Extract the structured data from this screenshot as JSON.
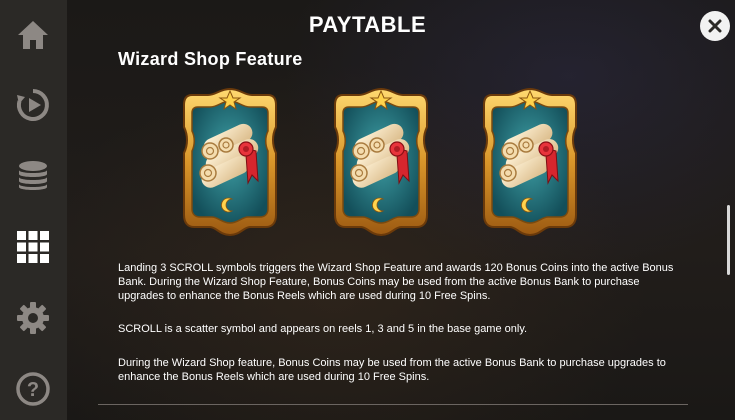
{
  "header": {
    "title": "PAYTABLE"
  },
  "sidebar": {
    "items": [
      {
        "icon": "home-icon"
      },
      {
        "icon": "autoplay-icon"
      },
      {
        "icon": "coins-stack-icon"
      },
      {
        "icon": "paytable-grid-icon",
        "active": true
      },
      {
        "icon": "gear-icon"
      },
      {
        "icon": "help-icon"
      }
    ]
  },
  "section": {
    "title": "Wizard Shop Feature",
    "symbols": [
      "scroll-symbol-icon",
      "scroll-symbol-icon",
      "scroll-symbol-icon"
    ],
    "paragraphs": [
      "Landing 3 SCROLL symbols triggers the Wizard Shop Feature and awards 120 Bonus Coins into the active Bonus Bank. During the Wizard Shop Feature, Bonus Coins may be used from the active Bonus Bank to purchase upgrades to enhance the Bonus Reels which are used during 10 Free Spins.",
      "SCROLL is a scatter symbol and appears on reels 1, 3 and 5 in the base game only.",
      "During the Wizard Shop feature, Bonus Coins may be used from the active Bonus Bank to purchase upgrades to enhance the Bonus Reels which are used during 10 Free Spins."
    ]
  },
  "colors": {
    "sidebar_bg": "#2b2926",
    "icon_inactive": "#8d8884",
    "icon_active": "#ffffff",
    "text": "#ffffff",
    "frame_gold": "#d49a2a",
    "frame_teal": "#1f6e78"
  }
}
